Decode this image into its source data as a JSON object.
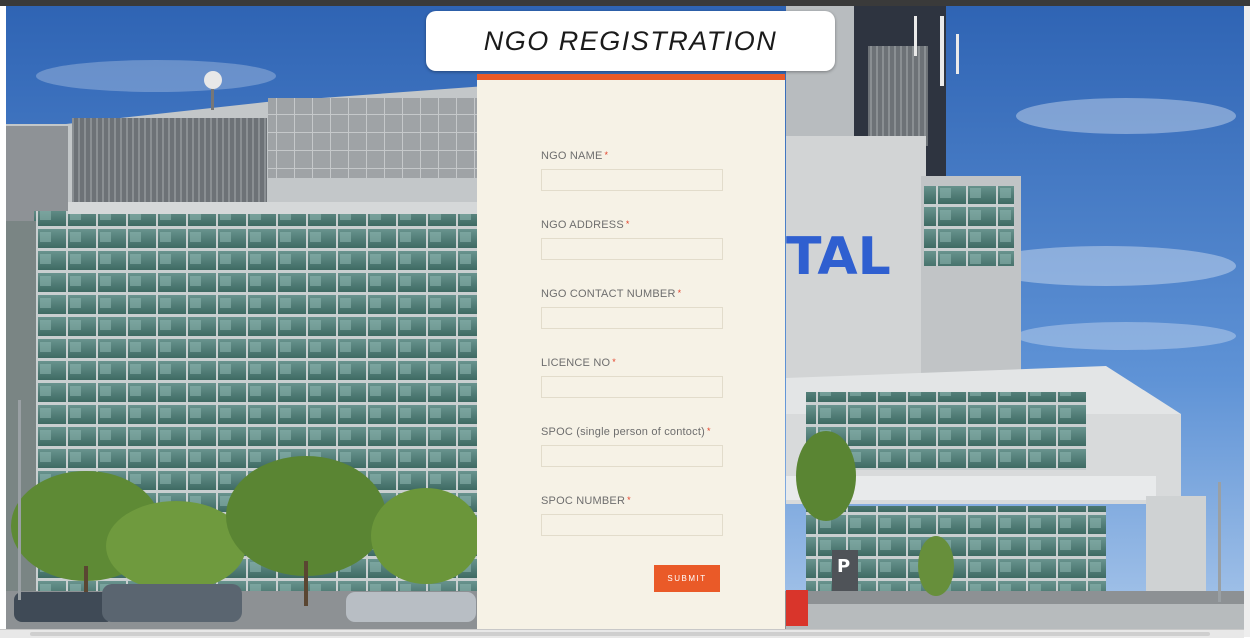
{
  "page": {
    "title": "NGO REGISTRATION"
  },
  "backdrop": {
    "description_icon": "hospital-building-photo-icon",
    "sign_text": "TAL",
    "parking_sign": "P"
  },
  "form": {
    "fields": [
      {
        "label": "NGO NAME",
        "required": "*",
        "value": ""
      },
      {
        "label": "NGO ADDRESS",
        "required": "*",
        "value": ""
      },
      {
        "label": "NGO CONTACT NUMBER",
        "required": "*",
        "value": ""
      },
      {
        "label": "LICENCE NO",
        "required": "*",
        "value": ""
      },
      {
        "label": "SPOC (single person of contoct)",
        "required": "*",
        "value": ""
      },
      {
        "label": "SPOC NUMBER",
        "required": "*",
        "value": ""
      }
    ],
    "submit_label": "SUBMIT"
  },
  "colors": {
    "accent": "#ea5a28",
    "panel": "#f6f2e6",
    "required": "#e4422a"
  }
}
